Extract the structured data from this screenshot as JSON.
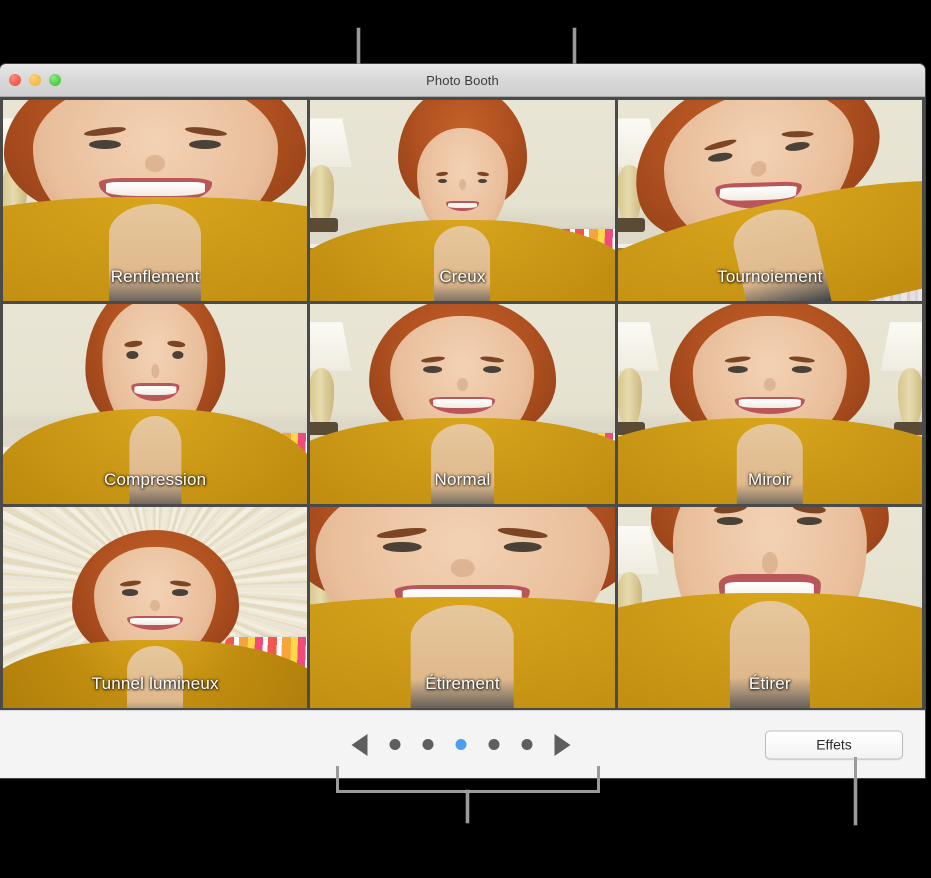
{
  "window": {
    "title": "Photo Booth",
    "traffic_lights": [
      {
        "name": "close",
        "color": "#f4564c"
      },
      {
        "name": "minimize",
        "color": "#f6b73c"
      },
      {
        "name": "maximize",
        "color": "#4bcd42"
      }
    ]
  },
  "effects_grid": {
    "columns": 3,
    "rows": 3,
    "cells": [
      {
        "label": "Renflement",
        "effect": "bulge",
        "selected": false
      },
      {
        "label": "Creux",
        "effect": "pinch",
        "selected": false
      },
      {
        "label": "Tournoiement",
        "effect": "twirl",
        "selected": false
      },
      {
        "label": "Compression",
        "effect": "squeeze",
        "selected": false
      },
      {
        "label": "Normal",
        "effect": "normal",
        "selected": true
      },
      {
        "label": "Miroir",
        "effect": "mirror",
        "selected": false
      },
      {
        "label": "Tunnel lumineux",
        "effect": "tunnel",
        "selected": false
      },
      {
        "label": "Étirement",
        "effect": "stretch",
        "selected": false
      },
      {
        "label": "Étirer",
        "effect": "distort",
        "selected": false
      }
    ]
  },
  "toolbar": {
    "prev_arrow_icon": "triangle-left-icon",
    "next_arrow_icon": "triangle-right-icon",
    "page_count": 5,
    "current_page": 3,
    "active_dot_color": "#4a9df0",
    "inactive_dot_color": "#5e5e5e",
    "effects_button_label": "Effets"
  },
  "annotations": {
    "count": 4,
    "description": "callout leader lines pointing to the effect grid, the page dots and the Effets button"
  }
}
